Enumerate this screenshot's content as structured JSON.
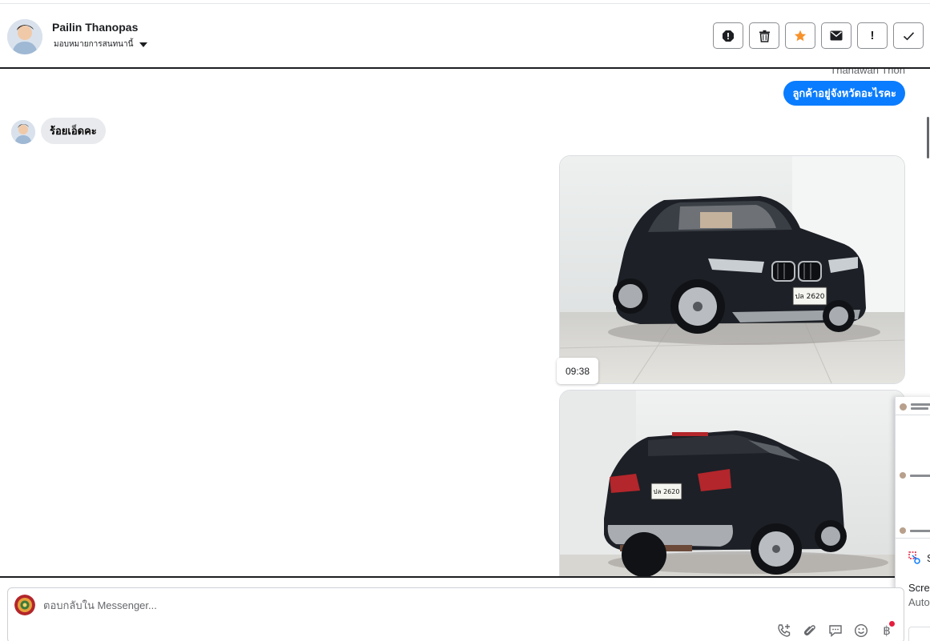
{
  "header": {
    "contact_name": "Pailin Thanopas",
    "assign_label": "มอบหมายการสนทนานี้",
    "actions": [
      {
        "name": "spam-alert-icon"
      },
      {
        "name": "trash-icon"
      },
      {
        "name": "star-icon"
      },
      {
        "name": "mail-icon"
      },
      {
        "name": "follow-up-icon",
        "glyph": "!"
      },
      {
        "name": "checkmark-icon"
      }
    ]
  },
  "conversation": {
    "sender_name": "Thanawan Thon",
    "outgoing_message": "ลูกค้าอยู่จังหวัดอะไรคะ",
    "incoming_message": "ร้อยเอ็ดคะ",
    "photo_time": "09:38",
    "plate_text": "ปล 2620"
  },
  "composer": {
    "placeholder": "ตอบกลับใน Messenger..."
  },
  "mini_preview": {
    "screen_label": "Scre",
    "auto_label": "Auto",
    "s_label": "S"
  },
  "colors": {
    "accent": "#0a7cff",
    "star": "#f7922a",
    "incoming_bubble": "#e9eaed",
    "badge": "#e41e3f"
  }
}
